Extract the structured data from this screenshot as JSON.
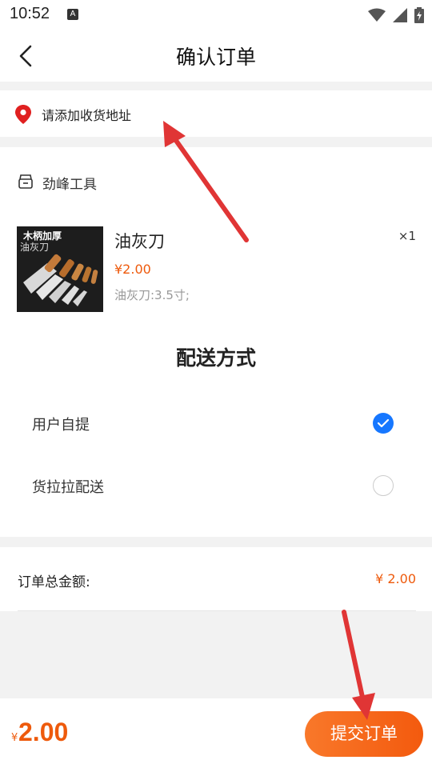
{
  "status_bar": {
    "time": "10:52",
    "notification_badge": "A",
    "icons": [
      "wifi-icon",
      "signal-icon",
      "battery-icon"
    ]
  },
  "navbar": {
    "title": "确认订单",
    "back_icon": "chevron-left-icon"
  },
  "address": {
    "placeholder": "请添加收货地址",
    "icon": "location-pin-icon",
    "icon_color": "#e02020"
  },
  "shop": {
    "name": "劲峰工具",
    "icon": "shop-icon"
  },
  "product": {
    "image_caption_line1": "木柄加厚",
    "image_caption_line2": "油灰刀",
    "name": "油灰刀",
    "quantity": "×1",
    "price": "¥2.00",
    "spec": "油灰刀:3.5寸;"
  },
  "delivery": {
    "title": "配送方式",
    "options": [
      {
        "label": "用户自提",
        "checked": true
      },
      {
        "label": "货拉拉配送",
        "checked": false
      }
    ]
  },
  "summary": {
    "total_label": "订单总金额:",
    "total_value": "¥ 2.00"
  },
  "bottom_bar": {
    "currency": "¥",
    "price": "2.00",
    "submit_label": "提交订单"
  },
  "colors": {
    "accent": "#ee5a0c",
    "check_blue": "#1677ff",
    "annotation_arrow": "#e03535"
  }
}
